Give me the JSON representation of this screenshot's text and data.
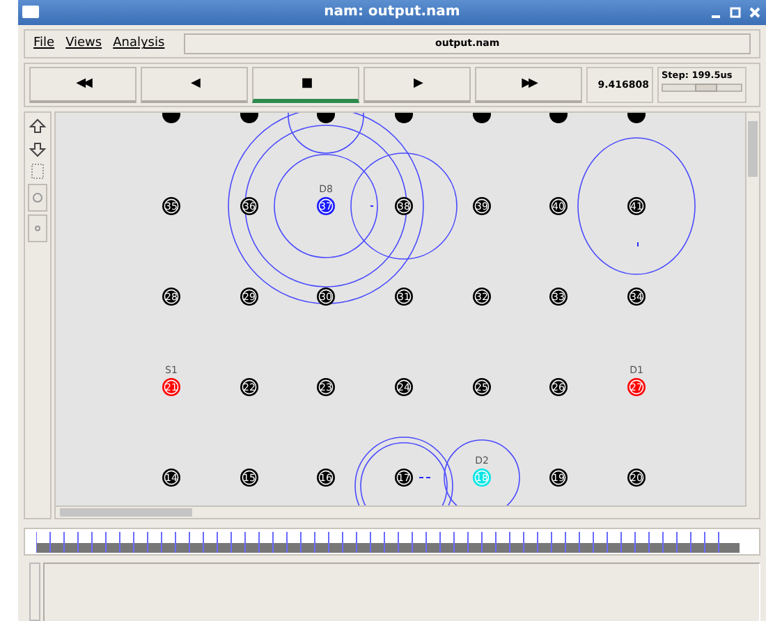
{
  "window": {
    "title": "nam: output.nam"
  },
  "menu": [
    "File",
    "Views",
    "Analysis"
  ],
  "file_field": {
    "value": "output.nam"
  },
  "transport": [
    {
      "label": "◀◀",
      "selected": false
    },
    {
      "label": "◀",
      "selected": false
    },
    {
      "label": "■",
      "selected": true
    },
    {
      "label": "▶",
      "selected": false
    },
    {
      "label": "▶▶",
      "selected": false
    }
  ],
  "time": "9.416808",
  "step": {
    "label": "Step: 199.5us",
    "level": 0.55
  },
  "nodes": [
    [
      {
        "label": "35",
        "color": "#000000"
      },
      {
        "label": "36",
        "color": "#000000"
      },
      {
        "label": "37",
        "color": "#1a1aff",
        "tag": "D8"
      },
      {
        "label": "38",
        "color": "#000000"
      },
      {
        "label": "39",
        "color": "#000000"
      },
      {
        "label": "40",
        "color": "#000000"
      },
      {
        "label": "41",
        "color": "#000000"
      }
    ],
    [
      {
        "label": "28",
        "color": "#000000"
      },
      {
        "label": "29",
        "color": "#000000"
      },
      {
        "label": "30",
        "color": "#000000"
      },
      {
        "label": "31",
        "color": "#000000"
      },
      {
        "label": "32",
        "color": "#000000"
      },
      {
        "label": "33",
        "color": "#000000"
      },
      {
        "label": "34",
        "color": "#000000"
      }
    ],
    [
      {
        "label": "21",
        "color": "#ff0000",
        "tag": "S1"
      },
      {
        "label": "22",
        "color": "#000000"
      },
      {
        "label": "23",
        "color": "#000000"
      },
      {
        "label": "24",
        "color": "#000000"
      },
      {
        "label": "25",
        "color": "#000000"
      },
      {
        "label": "26",
        "color": "#000000"
      },
      {
        "label": "27",
        "color": "#ff0000",
        "tag": "D1"
      }
    ],
    [
      {
        "label": "14",
        "color": "#000000"
      },
      {
        "label": "15",
        "color": "#000000"
      },
      {
        "label": "16",
        "color": "#000000"
      },
      {
        "label": "17",
        "color": "#000000"
      },
      {
        "label": "18",
        "color": "#00e5e5",
        "tag": "D2"
      },
      {
        "label": "19",
        "color": "#000000"
      },
      {
        "label": "20",
        "color": "#000000"
      }
    ]
  ]
}
